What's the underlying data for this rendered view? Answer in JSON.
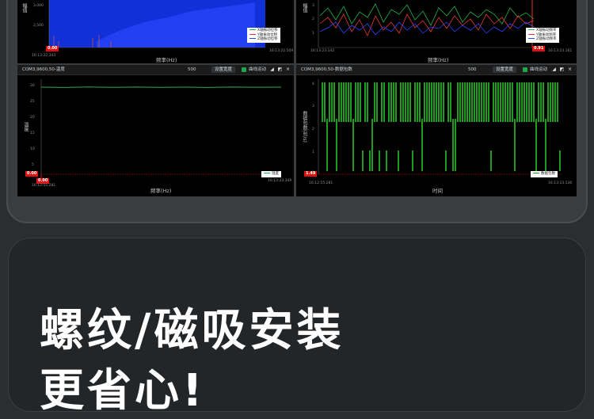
{
  "panels": {
    "top_left": {
      "xlabel": "频率(Hz)",
      "ylabel": "幅值",
      "tick_y": [
        "3,000",
        "2,500"
      ],
      "tick_left_x": "16:13:22.343",
      "tick_right_x": "16:13:22.509",
      "red_value": "0.00",
      "legend": [
        "X轴振动位移",
        "Y轴振动位移",
        "Z轴振动位移"
      ]
    },
    "top_right": {
      "xlabel": "频率(Hz)",
      "ylabel": "幅值",
      "tick_y": [
        "3",
        "2",
        "1"
      ],
      "tick_left_x": "16:13:23.142",
      "tick_right_x": "16:13:23.161",
      "red_value": "0.91",
      "legend": [
        "X轴振动频率",
        "Y轴振动频率",
        "Z轴振动频率"
      ]
    },
    "bottom_left": {
      "title": "COM3,9600,50-温度",
      "points": "500",
      "set_width_button": "设置宽度",
      "curve_move_label": "曲线运动",
      "ylabel": "温度",
      "xlabel": "频率(Hz)",
      "tick_y": [
        "30",
        "25",
        "20",
        "15",
        "10",
        "5"
      ],
      "tick_left_x": "16:12:55.281",
      "tick_right_x": "16:13:23.349",
      "red_value_left": "0.00",
      "red_value_bottom": "0.00",
      "legend": [
        "温度"
      ]
    },
    "bottom_right": {
      "title": "COM3,9600,50-数据包数",
      "points": "500",
      "set_width_button": "设置宽度",
      "curve_move_label": "曲线运动",
      "ylabel": "数据包数(包/s)",
      "xlabel": "时间",
      "tick_y": [
        "4",
        "3",
        "2",
        "1",
        "0"
      ],
      "tick_left_x": "16:12:55.281",
      "tick_right_x": "16:13:23.136",
      "red_value": "1.49",
      "legend": [
        "数据包数"
      ]
    }
  },
  "headline": {
    "line1": "螺纹/磁吸安装",
    "line2": "更省心!"
  },
  "colors": {
    "x_series": "#22b14c",
    "y_series": "#e53935",
    "z_series": "#2a46ff",
    "temperature": "#2fa84f",
    "packet": "#1f9b1f"
  }
}
